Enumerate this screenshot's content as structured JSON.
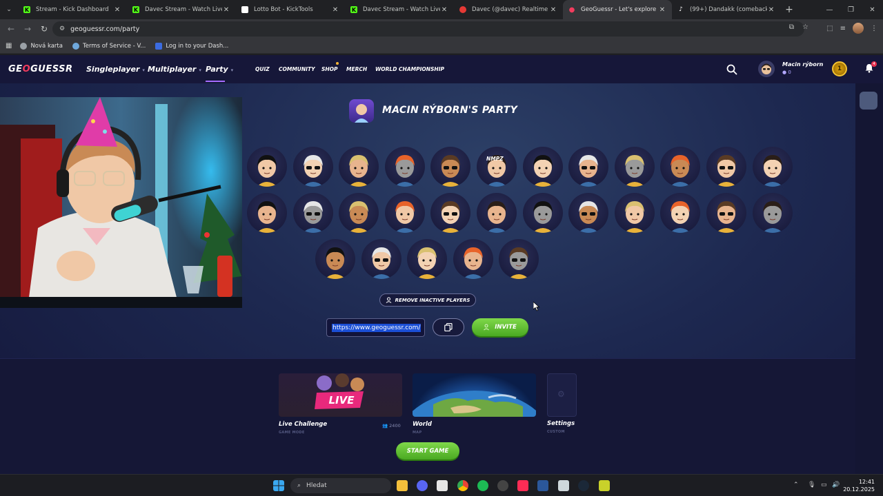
{
  "browser": {
    "tabs": [
      {
        "title": "Stream - Kick Dashboard",
        "favicon": "kick-icon",
        "color": "#53fc18"
      },
      {
        "title": "Davec Stream - Watch Live on K",
        "favicon": "kick-icon",
        "color": "#53fc18"
      },
      {
        "title": "Lotto Bot - KickTools",
        "favicon": "kicktools-icon",
        "color": "#ffffff"
      },
      {
        "title": "Davec Stream - Watch Live on K",
        "favicon": "kick-icon",
        "color": "#53fc18"
      },
      {
        "title": "Davec (@davec) Realtime Kick",
        "favicon": "realtime-icon",
        "color": "#e53935"
      },
      {
        "title": "GeoGuessr - Let's explore the w",
        "favicon": "geoguessr-pin-icon",
        "color": "#f23c5e",
        "active": true
      },
      {
        "title": "(99+) Dandakk (comeback) (@c",
        "favicon": "tiktok-icon",
        "color": "#ffffff"
      }
    ],
    "url": "geoguessr.com/party",
    "bookmarks": [
      {
        "label": "Nová karta",
        "icon": "globe-icon"
      },
      {
        "label": "Terms of Service - V...",
        "icon": "v-icon"
      },
      {
        "label": "Log in to your Dash...",
        "icon": "dash-icon"
      }
    ]
  },
  "header": {
    "logo_pre": "GE",
    "logo_o": "O",
    "logo_post": "GUESSR",
    "nav_main": [
      "Singleplayer",
      "Multiplayer",
      "Party"
    ],
    "nav_small": [
      "QUIZ",
      "COMMUNITY",
      "SHOP",
      "MERCH",
      "WORLD CHAMPIONSHIP"
    ],
    "user_name": "Macin rýborn",
    "user_coins": "0",
    "level": "1",
    "notifications": "4"
  },
  "party": {
    "title": "MACIN RÝBORN'S PARTY",
    "avatar_label_nmpz": "NMPZ",
    "remove_inactive": "REMOVE INACTIVE PLAYERS",
    "invite_link": "https://www.geoguessr.com/",
    "invite_label": "INVITE"
  },
  "game": {
    "live": {
      "title": "Live Challenge",
      "sub": "GAME MODE",
      "players": "2400",
      "banner": "LIVE"
    },
    "map": {
      "title": "World",
      "sub": "MAP"
    },
    "settings": {
      "title": "Settings",
      "sub": "CUSTOM"
    },
    "start": "START GAME"
  },
  "taskbar": {
    "search_label": "Hledat",
    "time": "12:41",
    "date": "20.12.2025"
  }
}
